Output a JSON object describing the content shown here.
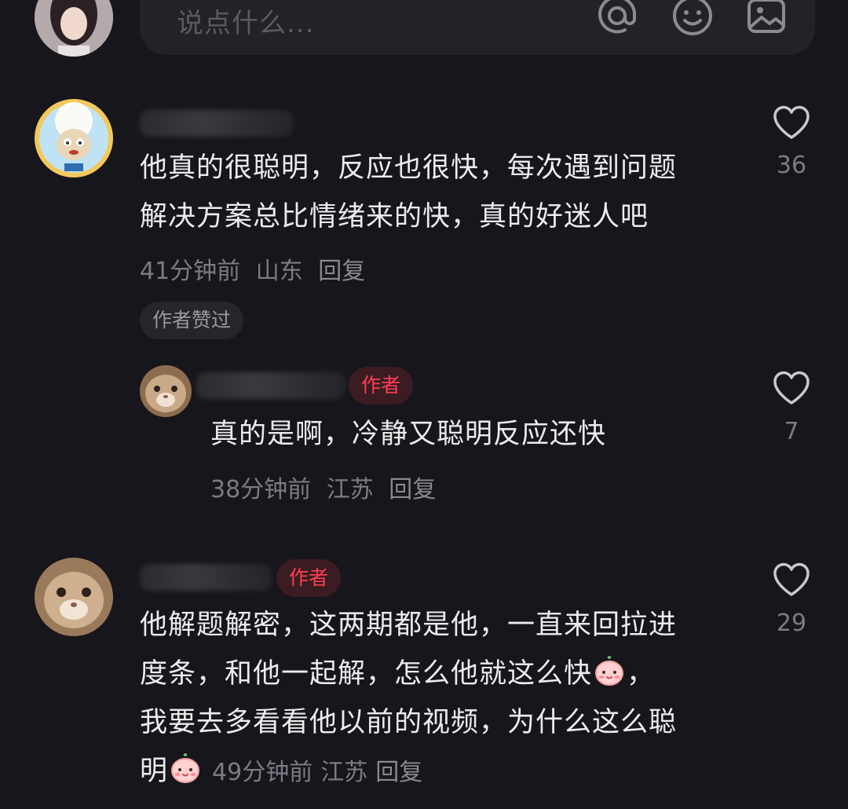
{
  "composer": {
    "placeholder": "说点什么..."
  },
  "comments": [
    {
      "text_lines": [
        "他真的很聪明，反应也很快，每次遇到问题",
        "解决方案总比情绪来的快，真的好迷人吧"
      ],
      "time": "41分钟前",
      "location": "山东",
      "reply_label": "回复",
      "liked_tag": "作者赞过",
      "like_count": "36",
      "replies": [
        {
          "badge": "作者",
          "text": "真的是啊，冷静又聪明反应还快",
          "time": "38分钟前",
          "location": "江苏",
          "reply_label": "回复",
          "like_count": "7"
        }
      ]
    },
    {
      "badge": "作者",
      "text_lines": [
        "他解题解密，这两期都是他，一直来回拉进",
        "度条，和他一起解，怎么他就这么快",
        "我要去多看看他以前的视频，为什么这么聪",
        "明"
      ],
      "line2_suffix": "，",
      "time": "49分钟前",
      "location": "江苏",
      "reply_label": "回复",
      "like_count": "29"
    }
  ],
  "colors": {
    "background": "#17161c",
    "author_badge": "#ff3e55",
    "muted": "#7c7b83"
  }
}
